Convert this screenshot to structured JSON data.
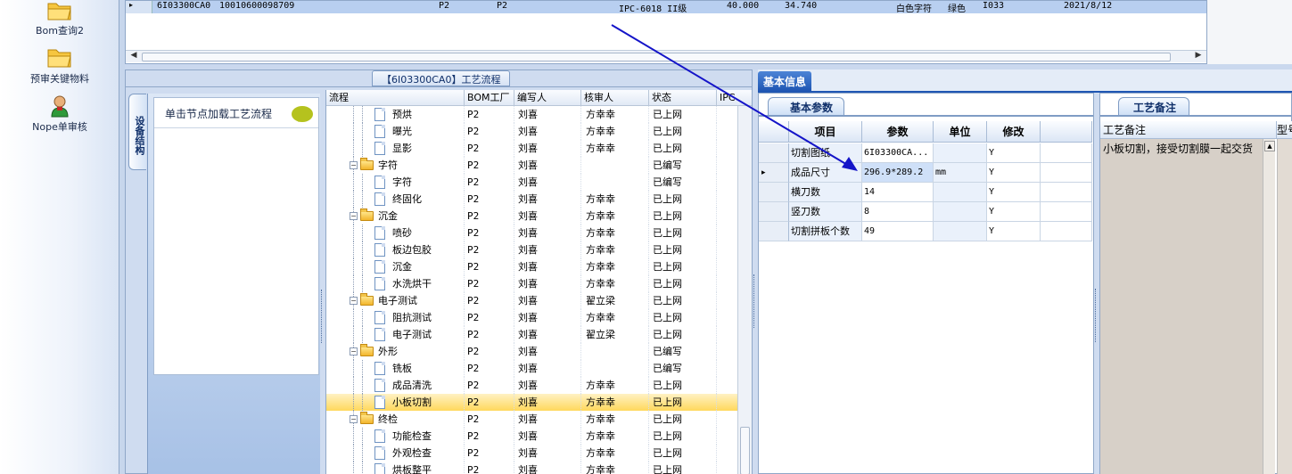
{
  "left_nav": {
    "items": [
      {
        "label": "Bom查询2",
        "icon": "folder-icon"
      },
      {
        "label": "预审关键物料",
        "icon": "folder-icon"
      },
      {
        "label": "Nope单审核",
        "icon": "user-icon"
      }
    ]
  },
  "top_grid": {
    "row_indicator": "▸",
    "cells": [
      "6I03300CA0",
      "10010600098709",
      "P2",
      "P2",
      "IPC-6018 II级",
      "40.000",
      "34.740",
      "白色字符",
      "绿色",
      "I033",
      "2021/8/12"
    ]
  },
  "middle": {
    "caption": "【6I03300CA0】工艺流程",
    "vertical_tab": "设备结构",
    "hint": "单击节点加载工艺流程",
    "columns": [
      "流程",
      "BOM工厂",
      "编写人",
      "核审人",
      "状态",
      "IPC"
    ],
    "rows": [
      {
        "level": 1,
        "kind": "doc",
        "name": "预烘",
        "bom": "P2",
        "writer": "刘喜",
        "reviewer": "方幸幸",
        "status": "已上网"
      },
      {
        "level": 1,
        "kind": "doc",
        "name": "曝光",
        "bom": "P2",
        "writer": "刘喜",
        "reviewer": "方幸幸",
        "status": "已上网"
      },
      {
        "level": 1,
        "kind": "doc",
        "name": "显影",
        "bom": "P2",
        "writer": "刘喜",
        "reviewer": "方幸幸",
        "status": "已上网"
      },
      {
        "level": 0,
        "kind": "folder",
        "name": "字符",
        "bom": "P2",
        "writer": "刘喜",
        "reviewer": "",
        "status": "已编写"
      },
      {
        "level": 1,
        "kind": "doc",
        "name": "字符",
        "bom": "P2",
        "writer": "刘喜",
        "reviewer": "",
        "status": "已编写"
      },
      {
        "level": 1,
        "kind": "doc",
        "name": "终固化",
        "bom": "P2",
        "writer": "刘喜",
        "reviewer": "方幸幸",
        "status": "已上网"
      },
      {
        "level": 0,
        "kind": "folder",
        "name": "沉金",
        "bom": "P2",
        "writer": "刘喜",
        "reviewer": "方幸幸",
        "status": "已上网"
      },
      {
        "level": 1,
        "kind": "doc",
        "name": "喷砂",
        "bom": "P2",
        "writer": "刘喜",
        "reviewer": "方幸幸",
        "status": "已上网"
      },
      {
        "level": 1,
        "kind": "doc",
        "name": "板边包胶",
        "bom": "P2",
        "writer": "刘喜",
        "reviewer": "方幸幸",
        "status": "已上网"
      },
      {
        "level": 1,
        "kind": "doc",
        "name": "沉金",
        "bom": "P2",
        "writer": "刘喜",
        "reviewer": "方幸幸",
        "status": "已上网"
      },
      {
        "level": 1,
        "kind": "doc",
        "name": "水洗烘干",
        "bom": "P2",
        "writer": "刘喜",
        "reviewer": "方幸幸",
        "status": "已上网"
      },
      {
        "level": 0,
        "kind": "folder",
        "name": "电子测试",
        "bom": "P2",
        "writer": "刘喜",
        "reviewer": "翟立梁",
        "status": "已上网"
      },
      {
        "level": 1,
        "kind": "doc",
        "name": "阻抗测试",
        "bom": "P2",
        "writer": "刘喜",
        "reviewer": "方幸幸",
        "status": "已上网"
      },
      {
        "level": 1,
        "kind": "doc",
        "name": "电子测试",
        "bom": "P2",
        "writer": "刘喜",
        "reviewer": "翟立梁",
        "status": "已上网"
      },
      {
        "level": 0,
        "kind": "folder",
        "name": "外形",
        "bom": "P2",
        "writer": "刘喜",
        "reviewer": "",
        "status": "已编写"
      },
      {
        "level": 1,
        "kind": "doc",
        "name": "铣板",
        "bom": "P2",
        "writer": "刘喜",
        "reviewer": "",
        "status": "已编写"
      },
      {
        "level": 1,
        "kind": "doc",
        "name": "成品清洗",
        "bom": "P2",
        "writer": "刘喜",
        "reviewer": "方幸幸",
        "status": "已上网"
      },
      {
        "level": 1,
        "kind": "doc",
        "name": "小板切割",
        "bom": "P2",
        "writer": "刘喜",
        "reviewer": "方幸幸",
        "status": "已上网",
        "selected": true
      },
      {
        "level": 0,
        "kind": "folder",
        "name": "终检",
        "bom": "P2",
        "writer": "刘喜",
        "reviewer": "方幸幸",
        "status": "已上网"
      },
      {
        "level": 1,
        "kind": "doc",
        "name": "功能检查",
        "bom": "P2",
        "writer": "刘喜",
        "reviewer": "方幸幸",
        "status": "已上网"
      },
      {
        "level": 1,
        "kind": "doc",
        "name": "外观检查",
        "bom": "P2",
        "writer": "刘喜",
        "reviewer": "方幸幸",
        "status": "已上网"
      },
      {
        "level": 1,
        "kind": "doc",
        "name": "烘板整平",
        "bom": "P2",
        "writer": "刘喜",
        "reviewer": "方幸幸",
        "status": "已上网"
      }
    ]
  },
  "right": {
    "main_tab": "基本信息",
    "params_tab": "基本参数",
    "params_columns": [
      "项目",
      "参数",
      "单位",
      "修改"
    ],
    "params": [
      {
        "item": "切割图纸",
        "value": "6I03300CA...",
        "unit": "",
        "edit": "Y"
      },
      {
        "item": "成品尺寸",
        "value": "296.9*289.2",
        "unit": "mm",
        "edit": "Y",
        "current": true
      },
      {
        "item": "横刀数",
        "value": "14",
        "unit": "",
        "edit": "Y"
      },
      {
        "item": "竖刀数",
        "value": "8",
        "unit": "",
        "edit": "Y"
      },
      {
        "item": "切割拼板个数",
        "value": "49",
        "unit": "",
        "edit": "Y"
      }
    ],
    "remark_tab": "工艺备注",
    "remark_header": "工艺备注",
    "remark_header2": "型号",
    "remark_text": "小板切割，接受切割膜一起交货"
  },
  "colors": {
    "accent": "#1f56b3",
    "selection": "#ffd85c",
    "annotation_arrow": "#1414c8"
  }
}
